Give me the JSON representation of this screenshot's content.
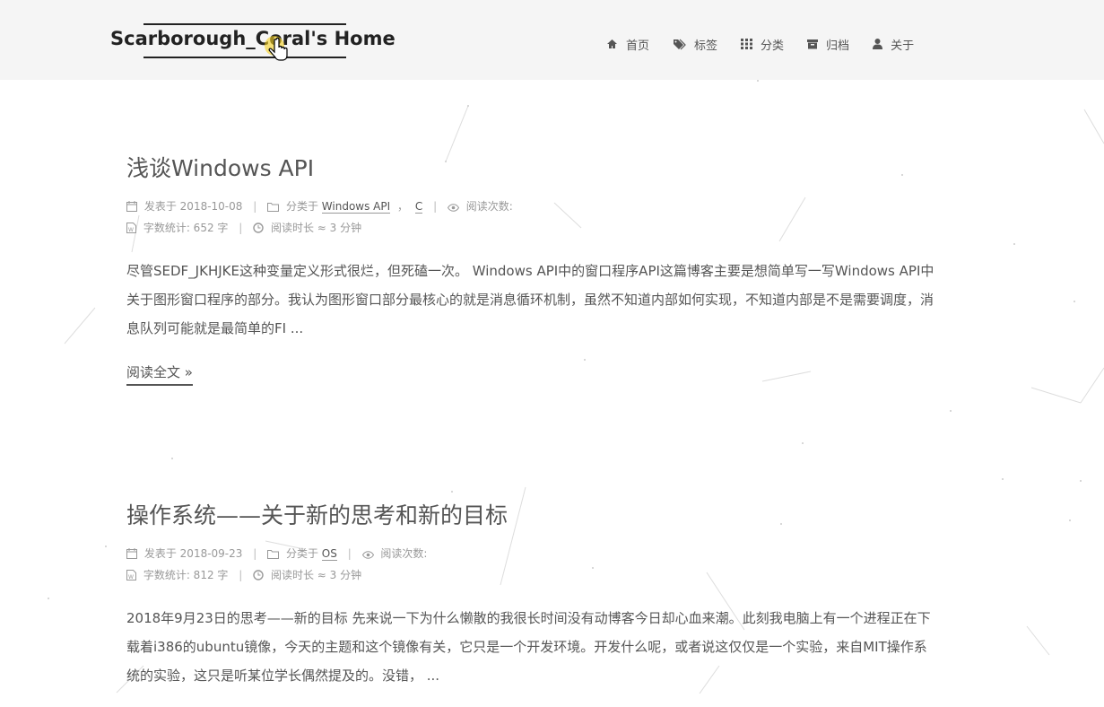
{
  "site": {
    "title": "Scarborough_Coral's Home"
  },
  "nav": [
    {
      "label": "首页",
      "icon": "home-icon"
    },
    {
      "label": "标签",
      "icon": "tags-icon"
    },
    {
      "label": "分类",
      "icon": "th-icon"
    },
    {
      "label": "归档",
      "icon": "archive-icon"
    },
    {
      "label": "关于",
      "icon": "user-icon"
    }
  ],
  "posts": [
    {
      "title": "浅谈Windows API",
      "posted_label": "发表于",
      "date": "2018-10-08",
      "category_label": "分类于",
      "categories": [
        "Windows API",
        "C"
      ],
      "category_separator": "，",
      "views_label": "阅读次数:",
      "wordcount": "字数统计: 652 字",
      "readtime": "阅读时长 ≈ 3 分钟",
      "excerpt": "尽管SEDF_JKHJKE这种变量定义形式很烂，但死磕一次。 Windows API中的窗口程序API这篇博客主要是想简单写一写Windows API中关于图形窗口程序的部分。我认为图形窗口部分最核心的就是消息循环机制，虽然不知道内部如何实现，不知道内部是不是需要调度，消息队列可能就是最简单的FI ...",
      "readmore": "阅读全文 »"
    },
    {
      "title": "操作系统——关于新的思考和新的目标",
      "posted_label": "发表于",
      "date": "2018-09-23",
      "category_label": "分类于",
      "categories": [
        "OS"
      ],
      "views_label": "阅读次数:",
      "wordcount": "字数统计: 812 字",
      "readtime": "阅读时长 ≈ 3 分钟",
      "excerpt": "2018年9月23日的思考——新的目标 先来说一下为什么懒散的我很长时间没有动博客今日却心血来潮。此刻我电脑上有一个进程正在下载着i386的ubuntu镜像，今天的主题和这个镜像有关，它只是一个开发环境。开发什么呢，或者说这仅仅是一个实验，来自MIT操作系统的实验，这只是听某位学长偶然提及的。没错， ..."
    }
  ],
  "separators": {
    "meta": "|"
  }
}
